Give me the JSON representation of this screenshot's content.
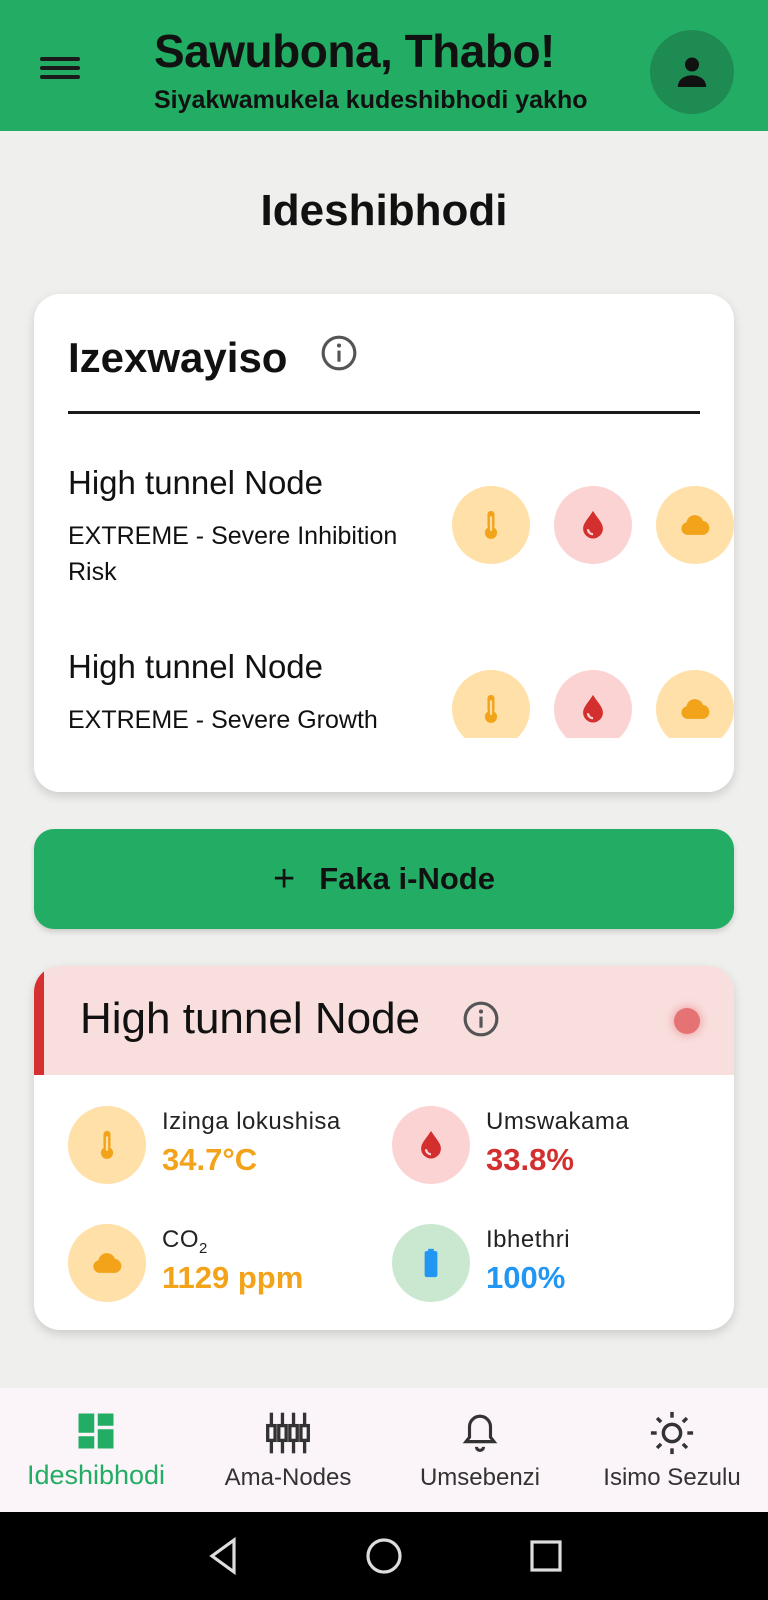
{
  "header": {
    "greeting": "Sawubona, Thabo!",
    "subtitle": "Siyakwamukela kudeshibhodi yakho",
    "menu_icon": "menu-icon",
    "avatar_icon": "person-icon",
    "color": "#23ad64"
  },
  "page": {
    "title": "Ideshibhodi"
  },
  "alerts": {
    "title": "Izexwayiso",
    "items": [
      {
        "node": "High tunnel Node",
        "description": "EXTREME - Severe Inhibition Risk",
        "icons": [
          "thermometer-icon",
          "drop-icon",
          "cloud-icon"
        ]
      },
      {
        "node": "High tunnel Node",
        "description": "EXTREME - Severe Growth Limitation",
        "icons": [
          "thermometer-icon",
          "drop-icon",
          "cloud-icon"
        ]
      }
    ]
  },
  "add_button": {
    "label": "Faka i-Node",
    "icon": "plus-icon"
  },
  "node_card": {
    "title": "High tunnel Node",
    "status_color": "#e57373",
    "metrics": {
      "temperature": {
        "label": "Izinga lokushisa",
        "value": "34.7°C",
        "color": "#f2a31a"
      },
      "humidity": {
        "label": "Umswakama",
        "value": "33.8%",
        "color": "#d32f2f"
      },
      "co2": {
        "label_main": "CO",
        "label_sub": "2",
        "value": "1129 ppm",
        "color": "#f2a31a"
      },
      "battery": {
        "label": "Ibhethri",
        "value": "100%",
        "color": "#2196f3"
      }
    }
  },
  "bottom_nav": {
    "items": [
      {
        "label": "Ideshibhodi",
        "icon": "dashboard-icon",
        "active": true
      },
      {
        "label": "Ama-Nodes",
        "icon": "sliders-icon",
        "active": false
      },
      {
        "label": "Umsebenzi",
        "icon": "bell-icon",
        "active": false
      },
      {
        "label": "Isimo Sezulu",
        "icon": "sun-icon",
        "active": false
      }
    ]
  }
}
